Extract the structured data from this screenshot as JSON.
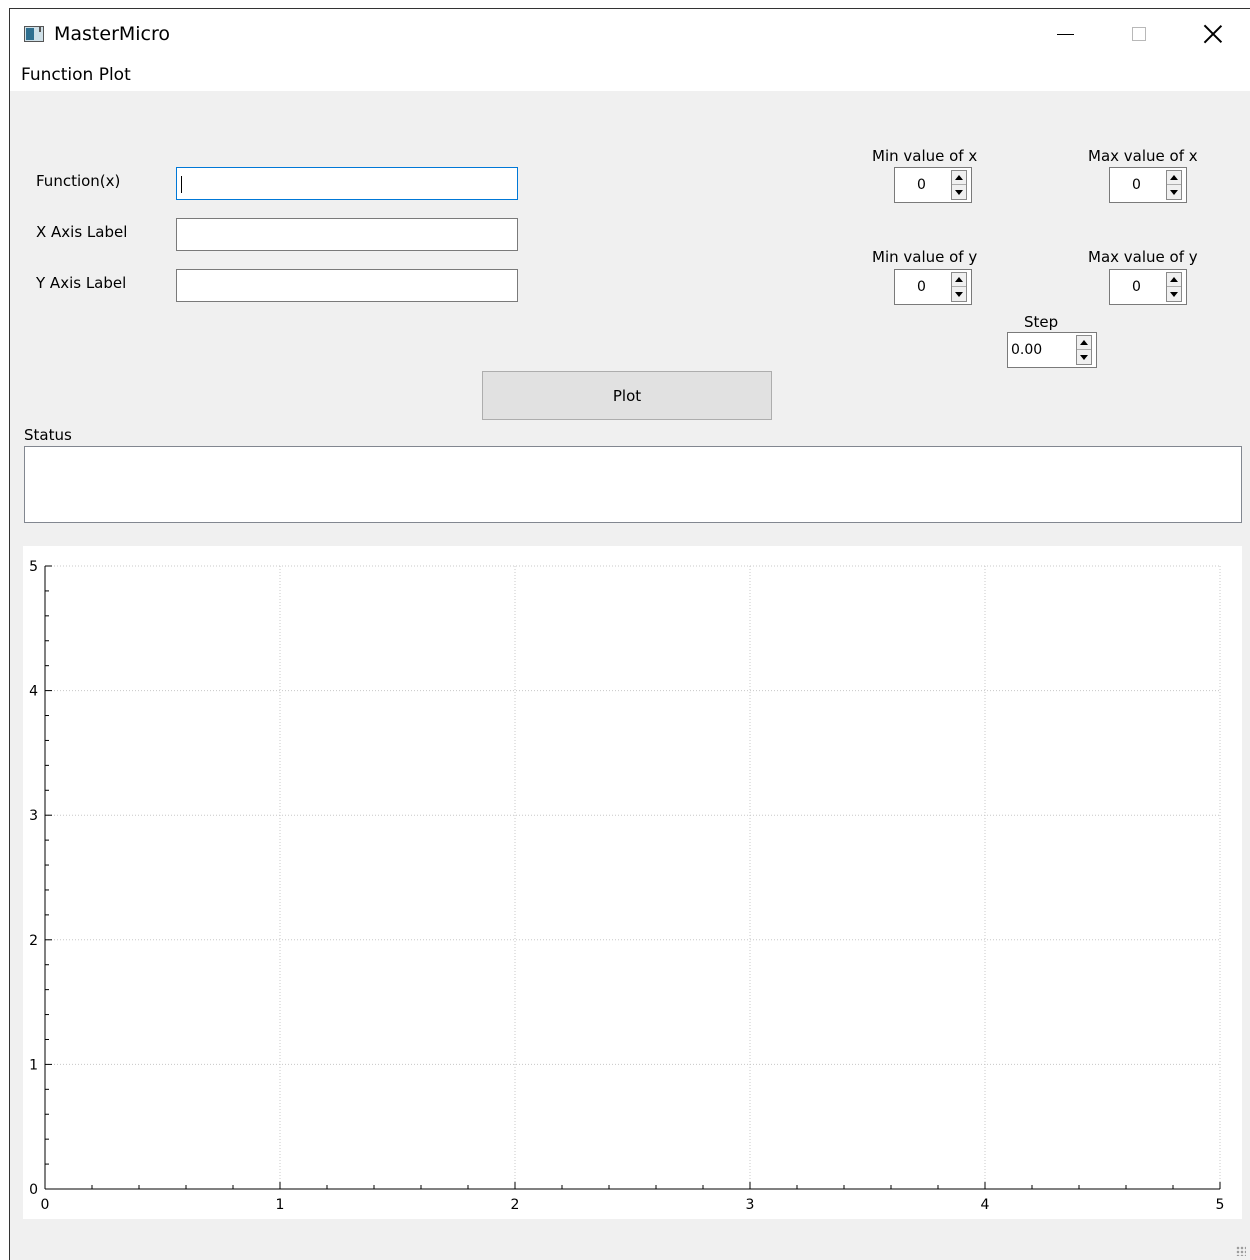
{
  "window": {
    "title": "MasterMicro",
    "icon": "app-window-icon",
    "controls": {
      "minimize": "minimize-icon",
      "maximize": "maximize-icon",
      "close": "close-icon"
    }
  },
  "menu": {
    "items": [
      "Function Plot"
    ]
  },
  "form": {
    "function_label": "Function(x)",
    "function_value": "",
    "xaxis_label": "X Axis Label",
    "xaxis_value": "",
    "yaxis_label": "Y Axis Label",
    "yaxis_value": ""
  },
  "ranges": {
    "min_x_label": "Min value of x",
    "min_x_value": "0",
    "max_x_label": "Max value of x",
    "max_x_value": "0",
    "min_y_label": "Min value of y",
    "min_y_value": "0",
    "max_y_label": "Max value of y",
    "max_y_value": "0",
    "step_label": "Step",
    "step_value": "0.00"
  },
  "actions": {
    "plot_label": "Plot"
  },
  "status": {
    "label": "Status",
    "text": ""
  },
  "chart_data": {
    "type": "line",
    "series": [],
    "xlim": [
      0,
      5
    ],
    "ylim": [
      0,
      5
    ],
    "x_ticks": [
      "0",
      "1",
      "2",
      "3",
      "4",
      "5"
    ],
    "y_ticks": [
      "0",
      "1",
      "2",
      "3",
      "4",
      "5"
    ],
    "grid": true,
    "minor_ticks_per_major": 5
  }
}
